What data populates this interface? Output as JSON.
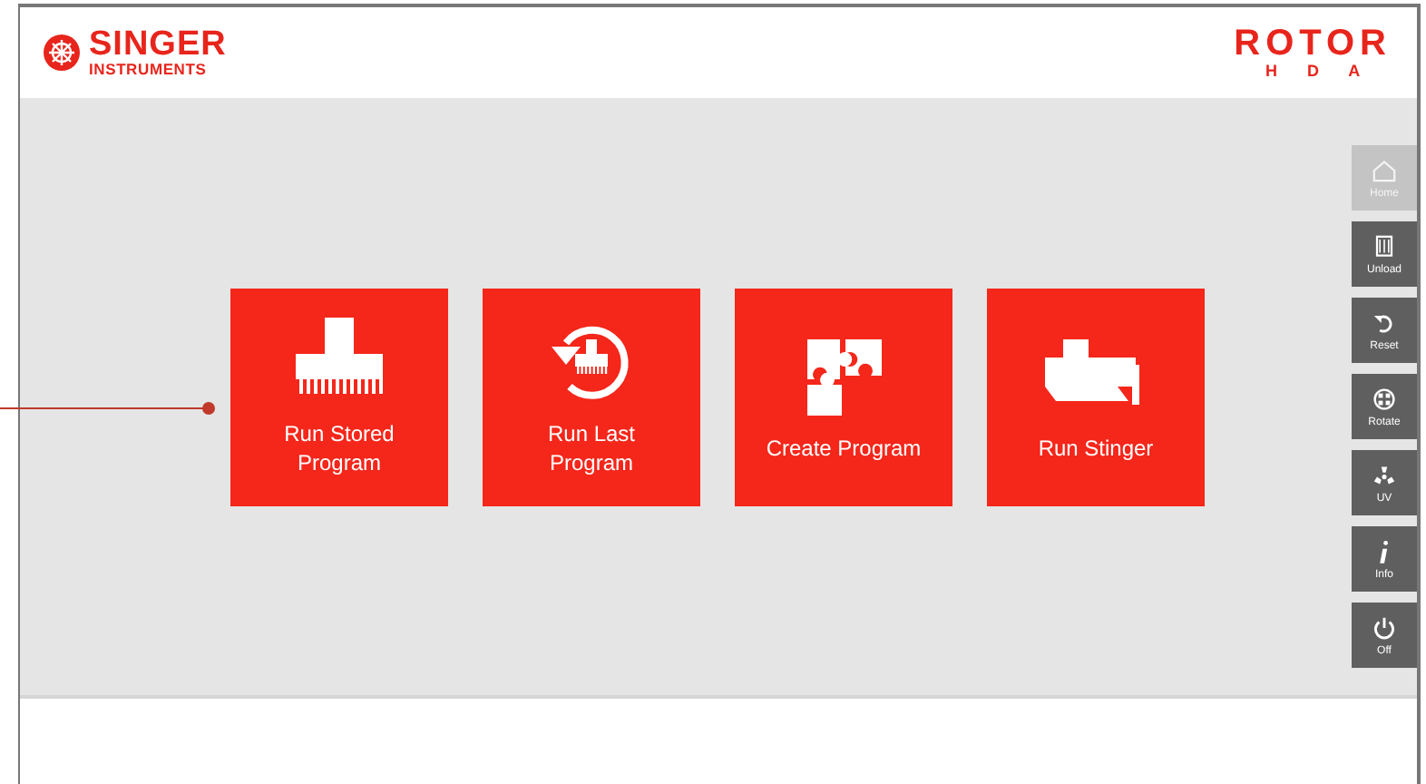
{
  "header": {
    "brand": {
      "name": "SINGER",
      "subtitle": "INSTRUMENTS"
    },
    "product": {
      "name": "ROTOR",
      "subtitle": "H D A"
    }
  },
  "tiles": [
    {
      "label": "Run Stored Program"
    },
    {
      "label": "Run Last Program"
    },
    {
      "label": "Create Program"
    },
    {
      "label": "Run Stinger"
    }
  ],
  "sidebar": [
    {
      "label": "Home",
      "disabled": true
    },
    {
      "label": "Unload",
      "disabled": false
    },
    {
      "label": "Reset",
      "disabled": false
    },
    {
      "label": "Rotate",
      "disabled": false
    },
    {
      "label": "UV",
      "disabled": false
    },
    {
      "label": "Info",
      "disabled": false
    },
    {
      "label": "Off",
      "disabled": false
    }
  ]
}
